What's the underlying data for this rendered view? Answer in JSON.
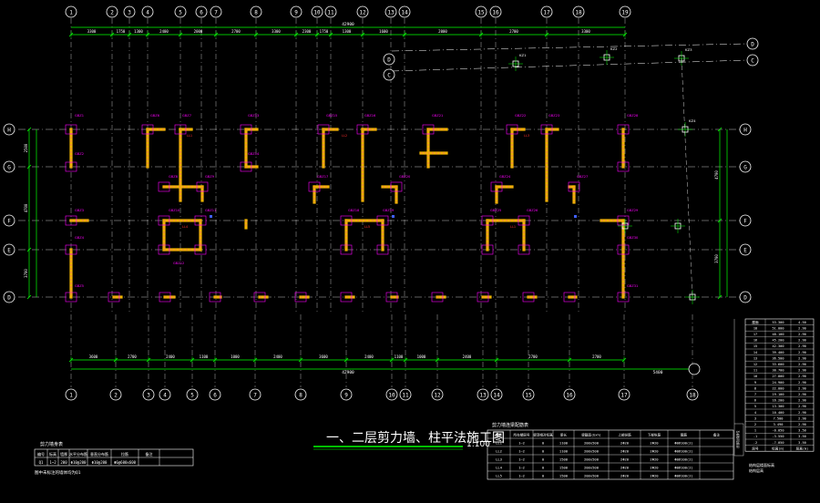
{
  "colors": {
    "background": "#000000",
    "axis": "#ffffff",
    "grid_dash": "#ffffff",
    "dimension": "#00ff00",
    "wall": "#f0b400",
    "wall_edge": "#ff00ff",
    "bubble": "#ffffff",
    "title": "#ffffff",
    "underline": "#00ff00",
    "marker_red": "#ff3030",
    "marker_blue": "#4060ff"
  },
  "drawing": {
    "title": "一、二层剪力墙、柱平法施工图",
    "scale": "1:100",
    "top_axes": [
      "1",
      "2",
      "3",
      "4",
      "5",
      "6",
      "7",
      "8",
      "9",
      "10",
      "11",
      "12",
      "13",
      "14",
      "15",
      "16",
      "17",
      "18",
      "19"
    ],
    "bottom_axes": [
      "1",
      "2",
      "3",
      "4",
      "5",
      "6",
      "7",
      "8",
      "9",
      "10",
      "11",
      "12",
      "13",
      "14",
      "15",
      "16",
      "17",
      "18"
    ],
    "left_axes": [
      "H",
      "G",
      "F",
      "E",
      "D"
    ],
    "right_axes": [
      "H",
      "G",
      "F",
      "E",
      "D"
    ],
    "top_right_axes": [
      "D",
      "C"
    ],
    "top_left_axes": [
      "D",
      "C"
    ],
    "overall_dim_top": "42900",
    "overall_dim_bottom": "42900",
    "overall_dim_bottom_right": "5400",
    "top_dims": [
      "3300",
      "1750",
      "1300",
      "2400",
      "2000",
      "2700",
      "3300",
      "2300",
      "1750",
      "1300",
      "1600",
      "2000",
      "2700",
      "3300"
    ],
    "bottom_dims": [
      "3600",
      "2700",
      "2400",
      "1100",
      "1000",
      "2400",
      "3600",
      "2400",
      "1100",
      "1000",
      "2400",
      "2700",
      "2700"
    ],
    "left_dims": [
      "2500",
      "4700",
      "3700"
    ],
    "right_dims": [
      "4700",
      "3700"
    ]
  },
  "table_left": {
    "title": "剪力墙身表",
    "headers": [
      "编号",
      "标高",
      "墙厚",
      "水平分布筋",
      "垂直分布筋",
      "拉筋",
      "备注"
    ],
    "rows": [
      [
        "Q1",
        "1~2",
        "200",
        "Φ10@200",
        "Φ10@200",
        "Φ6@600x600",
        ""
      ]
    ],
    "note": "图中未标注的墙体均为Q1"
  },
  "table_middle": {
    "title": "剪力墙连梁配筋表",
    "headers": [
      "编号",
      "所在楼层号",
      "梁顶相对标高",
      "梁长",
      "梁截面(bxh)",
      "上部纵筋",
      "下部纵筋",
      "箍筋",
      "备注"
    ],
    "rows": [
      [
        "LL1",
        "1~2",
        "0",
        "1100",
        "200x500",
        "2Φ20",
        "2Φ20",
        "Φ8@100(2)",
        ""
      ],
      [
        "LL2",
        "1~2",
        "0",
        "1100",
        "200x500",
        "2Φ20",
        "2Φ20",
        "Φ8@100(2)",
        ""
      ],
      [
        "LL3",
        "1~2",
        "0",
        "1500",
        "200x500",
        "2Φ20",
        "2Φ20",
        "Φ8@100(2)",
        ""
      ],
      [
        "LL4",
        "1~2",
        "0",
        "1500",
        "200x500",
        "2Φ20",
        "2Φ20",
        "Φ8@100(2)",
        ""
      ],
      [
        "LL5",
        "1~2",
        "0",
        "1500",
        "200x500",
        "2Φ20",
        "2Φ20",
        "Φ8@100(2)",
        ""
      ]
    ]
  },
  "table_right": {
    "title": "结构层楼面标高",
    "subtitle": "结构层高",
    "side_label": "底部加强部位",
    "top_label": "屋面",
    "rows": [
      [
        "屋面",
        "53.300",
        "4.50"
      ],
      [
        "18",
        "51.000",
        "2.90"
      ],
      [
        "17",
        "48.100",
        "2.90"
      ],
      [
        "16",
        "45.200",
        "2.90"
      ],
      [
        "15",
        "42.300",
        "2.90"
      ],
      [
        "14",
        "39.400",
        "2.90"
      ],
      [
        "13",
        "36.500",
        "2.90"
      ],
      [
        "12",
        "33.600",
        "2.90"
      ],
      [
        "11",
        "30.700",
        "2.90"
      ],
      [
        "10",
        "27.800",
        "2.90"
      ],
      [
        "9",
        "24.900",
        "2.90"
      ],
      [
        "8",
        "22.000",
        "2.90"
      ],
      [
        "7",
        "19.100",
        "2.90"
      ],
      [
        "6",
        "16.200",
        "2.90"
      ],
      [
        "5",
        "13.300",
        "2.90"
      ],
      [
        "4",
        "10.400",
        "2.90"
      ],
      [
        "3",
        "7.500",
        "2.90"
      ],
      [
        "2",
        "3.490",
        "2.90"
      ],
      [
        "1",
        "-0.050",
        "3.50"
      ],
      [
        "-1",
        "-3.550",
        "3.50"
      ],
      [
        "-2",
        "-7.050",
        "3.50"
      ],
      [
        "层号",
        "标高(m)",
        "层高(m)"
      ]
    ]
  },
  "labels": {
    "wall_tags": [
      "GBZ1",
      "GBZ2",
      "GBZ3",
      "GBZ4",
      "GBZ5",
      "GBZ6",
      "GBZ7",
      "GBZ8",
      "GBZ9",
      "GBZ10",
      "GBZ11",
      "GBZ12",
      "GBZ13",
      "GBZ14",
      "GBZ15",
      "GBZ16",
      "GBZ17",
      "GBZ18",
      "GBZ19",
      "GBZ20",
      "GBZ21",
      "GBZ22",
      "GBZ23",
      "GBZ24",
      "GBZ25",
      "GBZ26",
      "GBZ27",
      "GBZ28",
      "GBZ29",
      "GBZ30",
      "GBZ31"
    ],
    "column_tags": [
      "KZ1",
      "KZ2",
      "KZ3",
      "KZ4"
    ]
  }
}
